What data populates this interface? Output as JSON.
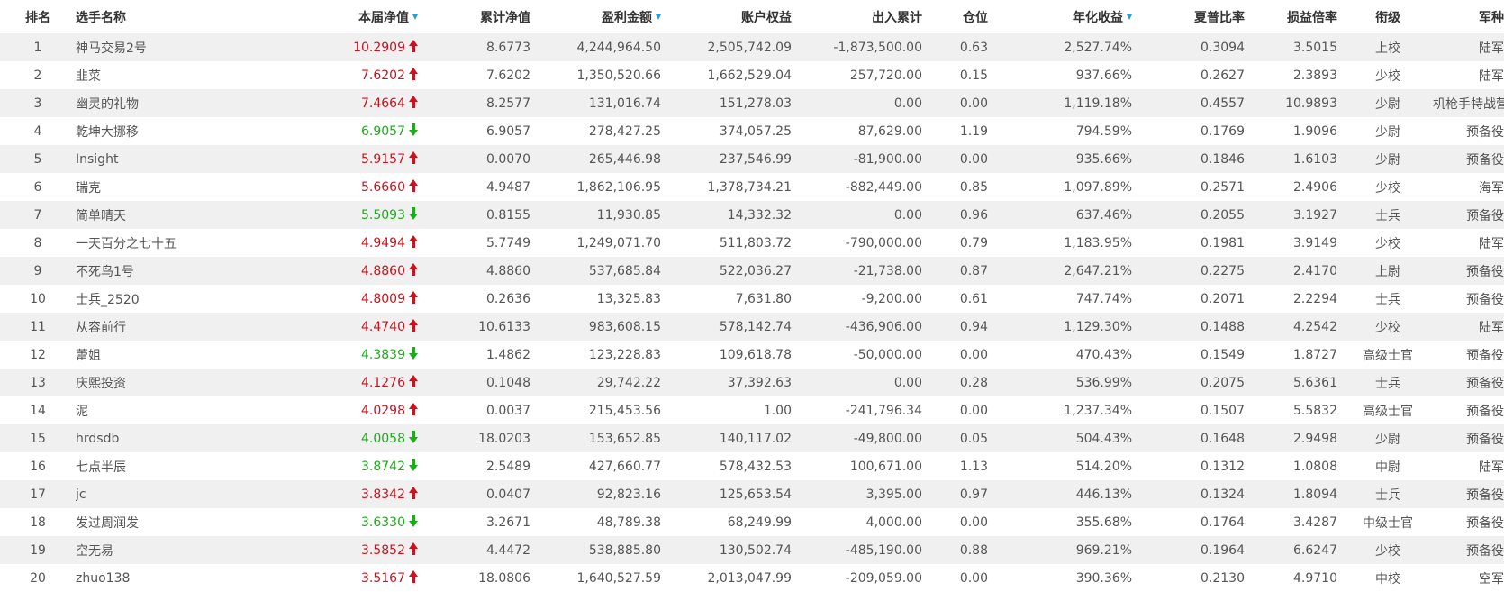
{
  "colors": {
    "up": "#c8141e",
    "down": "#1eaa1e",
    "sort_indicator": "#2a9fd6",
    "row_stripe": "#f0f0f0"
  },
  "columns": [
    {
      "key": "rank",
      "label": "排名",
      "sortable": false
    },
    {
      "key": "name",
      "label": "选手名称",
      "sortable": false
    },
    {
      "key": "nav",
      "label": "本届净值",
      "sortable": true
    },
    {
      "key": "cum_nav",
      "label": "累计净值",
      "sortable": false
    },
    {
      "key": "profit",
      "label": "盈利金额",
      "sortable": true
    },
    {
      "key": "equity",
      "label": "账户权益",
      "sortable": false
    },
    {
      "key": "flow",
      "label": "出入累计",
      "sortable": false
    },
    {
      "key": "position",
      "label": "仓位",
      "sortable": false
    },
    {
      "key": "annual",
      "label": "年化收益",
      "sortable": true
    },
    {
      "key": "sharpe",
      "label": "夏普比率",
      "sortable": false
    },
    {
      "key": "pl_ratio",
      "label": "损益倍率",
      "sortable": false
    },
    {
      "key": "grade",
      "label": "衔级",
      "sortable": false
    },
    {
      "key": "branch",
      "label": "军种",
      "sortable": false
    }
  ],
  "rows": [
    {
      "rank": "1",
      "name": "神马交易2号",
      "nav": "10.2909",
      "dir": "up",
      "cum_nav": "8.6773",
      "profit": "4,244,964.50",
      "equity": "2,505,742.09",
      "flow": "-1,873,500.00",
      "position": "0.63",
      "annual": "2,527.74%",
      "sharpe": "0.3094",
      "pl_ratio": "3.5015",
      "grade": "上校",
      "branch": "陆军"
    },
    {
      "rank": "2",
      "name": "韭菜",
      "nav": "7.6202",
      "dir": "up",
      "cum_nav": "7.6202",
      "profit": "1,350,520.66",
      "equity": "1,662,529.04",
      "flow": "257,720.00",
      "position": "0.15",
      "annual": "937.66%",
      "sharpe": "0.2627",
      "pl_ratio": "2.3893",
      "grade": "少校",
      "branch": "陆军"
    },
    {
      "rank": "3",
      "name": "幽灵的礼物",
      "nav": "7.4664",
      "dir": "up",
      "cum_nav": "8.2577",
      "profit": "131,016.74",
      "equity": "151,278.03",
      "flow": "0.00",
      "position": "0.00",
      "annual": "1,119.18%",
      "sharpe": "0.4557",
      "pl_ratio": "10.9893",
      "grade": "少尉",
      "branch": "机枪手特战营"
    },
    {
      "rank": "4",
      "name": "乾坤大挪移",
      "nav": "6.9057",
      "dir": "down",
      "cum_nav": "6.9057",
      "profit": "278,427.25",
      "equity": "374,057.25",
      "flow": "87,629.00",
      "position": "1.19",
      "annual": "794.59%",
      "sharpe": "0.1769",
      "pl_ratio": "1.9096",
      "grade": "少尉",
      "branch": "预备役"
    },
    {
      "rank": "5",
      "name": "Insight",
      "nav": "5.9157",
      "dir": "up",
      "cum_nav": "0.0070",
      "profit": "265,446.98",
      "equity": "237,546.99",
      "flow": "-81,900.00",
      "position": "0.00",
      "annual": "935.66%",
      "sharpe": "0.1846",
      "pl_ratio": "1.6103",
      "grade": "少尉",
      "branch": "预备役"
    },
    {
      "rank": "6",
      "name": "瑞克",
      "nav": "5.6660",
      "dir": "up",
      "cum_nav": "4.9487",
      "profit": "1,862,106.95",
      "equity": "1,378,734.21",
      "flow": "-882,449.00",
      "position": "0.85",
      "annual": "1,097.89%",
      "sharpe": "0.2571",
      "pl_ratio": "2.4906",
      "grade": "少校",
      "branch": "海军"
    },
    {
      "rank": "7",
      "name": "简单晴天",
      "nav": "5.5093",
      "dir": "down",
      "cum_nav": "0.8155",
      "profit": "11,930.85",
      "equity": "14,332.32",
      "flow": "0.00",
      "position": "0.96",
      "annual": "637.46%",
      "sharpe": "0.2055",
      "pl_ratio": "3.1927",
      "grade": "士兵",
      "branch": "预备役"
    },
    {
      "rank": "8",
      "name": "一天百分之七十五",
      "nav": "4.9494",
      "dir": "up",
      "cum_nav": "5.7749",
      "profit": "1,249,071.70",
      "equity": "511,803.72",
      "flow": "-790,000.00",
      "position": "0.79",
      "annual": "1,183.95%",
      "sharpe": "0.1981",
      "pl_ratio": "3.9149",
      "grade": "少校",
      "branch": "陆军"
    },
    {
      "rank": "9",
      "name": "不死鸟1号",
      "nav": "4.8860",
      "dir": "up",
      "cum_nav": "4.8860",
      "profit": "537,685.84",
      "equity": "522,036.27",
      "flow": "-21,738.00",
      "position": "0.87",
      "annual": "2,647.21%",
      "sharpe": "0.2275",
      "pl_ratio": "2.4170",
      "grade": "上尉",
      "branch": "预备役"
    },
    {
      "rank": "10",
      "name": "士兵_2520",
      "nav": "4.8009",
      "dir": "up",
      "cum_nav": "0.2636",
      "profit": "13,325.83",
      "equity": "7,631.80",
      "flow": "-9,200.00",
      "position": "0.61",
      "annual": "747.74%",
      "sharpe": "0.2071",
      "pl_ratio": "2.2294",
      "grade": "士兵",
      "branch": "预备役"
    },
    {
      "rank": "11",
      "name": "从容前行",
      "nav": "4.4740",
      "dir": "up",
      "cum_nav": "10.6133",
      "profit": "983,608.15",
      "equity": "578,142.74",
      "flow": "-436,906.00",
      "position": "0.94",
      "annual": "1,129.30%",
      "sharpe": "0.1488",
      "pl_ratio": "4.2542",
      "grade": "少校",
      "branch": "陆军"
    },
    {
      "rank": "12",
      "name": "蕾姐",
      "nav": "4.3839",
      "dir": "down",
      "cum_nav": "1.4862",
      "profit": "123,228.83",
      "equity": "109,618.78",
      "flow": "-50,000.00",
      "position": "0.00",
      "annual": "470.43%",
      "sharpe": "0.1549",
      "pl_ratio": "1.8727",
      "grade": "高级士官",
      "branch": "预备役"
    },
    {
      "rank": "13",
      "name": "庆熙投资",
      "nav": "4.1276",
      "dir": "up",
      "cum_nav": "0.1048",
      "profit": "29,742.22",
      "equity": "37,392.63",
      "flow": "0.00",
      "position": "0.28",
      "annual": "536.99%",
      "sharpe": "0.2075",
      "pl_ratio": "5.6361",
      "grade": "士兵",
      "branch": "预备役"
    },
    {
      "rank": "14",
      "name": "泥",
      "nav": "4.0298",
      "dir": "up",
      "cum_nav": "0.0037",
      "profit": "215,453.56",
      "equity": "1.00",
      "flow": "-241,796.34",
      "position": "0.00",
      "annual": "1,237.34%",
      "sharpe": "0.1507",
      "pl_ratio": "5.5832",
      "grade": "高级士官",
      "branch": "预备役"
    },
    {
      "rank": "15",
      "name": "hrdsdb",
      "nav": "4.0058",
      "dir": "down",
      "cum_nav": "18.0203",
      "profit": "153,652.85",
      "equity": "140,117.02",
      "flow": "-49,800.00",
      "position": "0.05",
      "annual": "504.43%",
      "sharpe": "0.1648",
      "pl_ratio": "2.9498",
      "grade": "少尉",
      "branch": "预备役"
    },
    {
      "rank": "16",
      "name": "七点半辰",
      "nav": "3.8742",
      "dir": "down",
      "cum_nav": "2.5489",
      "profit": "427,660.77",
      "equity": "578,432.53",
      "flow": "100,671.00",
      "position": "1.13",
      "annual": "514.20%",
      "sharpe": "0.1312",
      "pl_ratio": "1.0808",
      "grade": "中尉",
      "branch": "陆军"
    },
    {
      "rank": "17",
      "name": "jc",
      "nav": "3.8342",
      "dir": "up",
      "cum_nav": "0.0407",
      "profit": "92,823.16",
      "equity": "125,653.54",
      "flow": "3,395.00",
      "position": "0.97",
      "annual": "446.13%",
      "sharpe": "0.1324",
      "pl_ratio": "1.8094",
      "grade": "士兵",
      "branch": "预备役"
    },
    {
      "rank": "18",
      "name": "发过周润发",
      "nav": "3.6330",
      "dir": "down",
      "cum_nav": "3.2671",
      "profit": "48,789.38",
      "equity": "68,249.99",
      "flow": "4,000.00",
      "position": "0.00",
      "annual": "355.68%",
      "sharpe": "0.1764",
      "pl_ratio": "3.4287",
      "grade": "中级士官",
      "branch": "预备役"
    },
    {
      "rank": "19",
      "name": "空无易",
      "nav": "3.5852",
      "dir": "up",
      "cum_nav": "4.4472",
      "profit": "538,885.80",
      "equity": "130,502.74",
      "flow": "-485,190.00",
      "position": "0.88",
      "annual": "969.21%",
      "sharpe": "0.1964",
      "pl_ratio": "6.6247",
      "grade": "少校",
      "branch": "预备役"
    },
    {
      "rank": "20",
      "name": "zhuo138",
      "nav": "3.5167",
      "dir": "up",
      "cum_nav": "18.0806",
      "profit": "1,640,527.59",
      "equity": "2,013,047.99",
      "flow": "-209,059.00",
      "position": "0.00",
      "annual": "390.36%",
      "sharpe": "0.2130",
      "pl_ratio": "4.9710",
      "grade": "中校",
      "branch": "空军"
    }
  ]
}
